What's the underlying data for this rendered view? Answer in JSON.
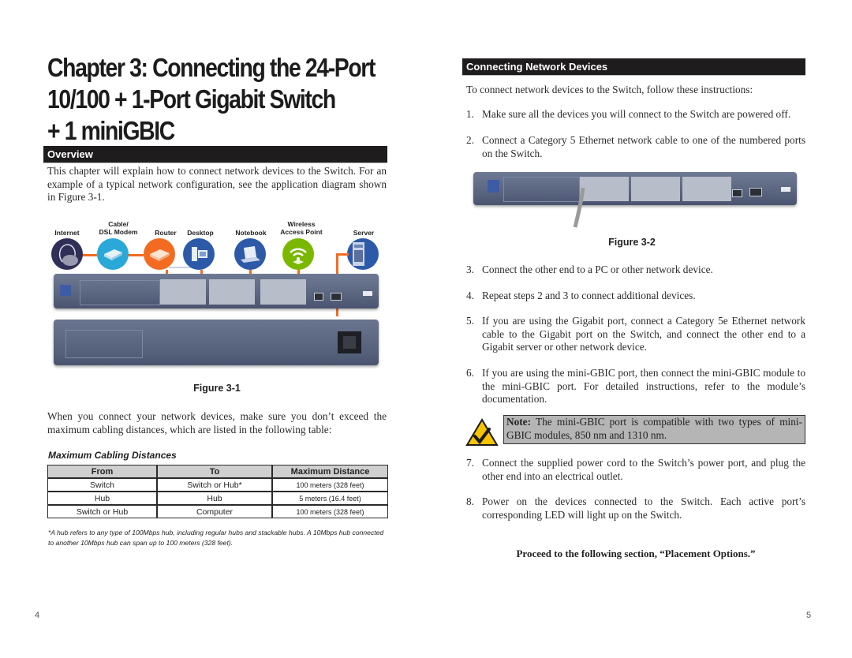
{
  "left_page": {
    "chapter_title_lines": [
      "Chapter 3: Connecting the 24-Port",
      "10/100 + 1-Port Gigabit Switch",
      "+ 1 miniGBIC"
    ],
    "overview": {
      "heading": "Overview",
      "paragraph": "This chapter will explain how to connect network devices to the Switch. For an example of a typical network configuration, see the application diagram shown in Figure 3-1."
    },
    "figure1": {
      "devices": [
        {
          "label": "Internet",
          "icon": "globe-icon",
          "color": "#2f2f57"
        },
        {
          "label": "Cable/\nDSL Modem",
          "icon": "modem-icon",
          "color": "#2aa8d8"
        },
        {
          "label": "Router",
          "icon": "router-icon",
          "color": "#f26b21"
        },
        {
          "label": "Desktop",
          "icon": "desktop-icon",
          "color": "#2d5aa8"
        },
        {
          "label": "Notebook",
          "icon": "notebook-icon",
          "color": "#2d5aa8"
        },
        {
          "label": "Wireless\nAccess Point",
          "icon": "wifi-icon",
          "color": "#7ab800"
        },
        {
          "label": "Server",
          "icon": "server-icon",
          "color": "#2d5aa8"
        }
      ],
      "caption": "Figure 3-1"
    },
    "cabling_paragraph": "When you connect your network devices, make sure you don’t exceed the maximum cabling distances, which are listed in the following table:",
    "table": {
      "title": "Maximum Cabling Distances",
      "headers": [
        "From",
        "To",
        "Maximum Distance"
      ],
      "rows": [
        [
          "Switch",
          "Switch or Hub*",
          "100 meters (328 feet)"
        ],
        [
          "Hub",
          "Hub",
          "5 meters (16.4 feet)"
        ],
        [
          "Switch or Hub",
          "Computer",
          "100 meters (328 feet)"
        ]
      ],
      "footnote": "*A hub refers to any type of 100Mbps hub, including regular hubs and stackable hubs. A 10Mbps hub connected to another 10Mbps hub can span up to 100 meters (328 feet)."
    },
    "page_number": "4"
  },
  "right_page": {
    "section_heading": "Connecting Network Devices",
    "intro": "To connect network devices to the Switch, follow these instructions:",
    "steps": [
      {
        "num": "1.",
        "text": "Make sure all the devices you will connect to the Switch are powered off."
      },
      {
        "num": "2.",
        "text": "Connect a Category 5 Ethernet network cable to one of the numbered ports on the Switch."
      },
      {
        "num": "3.",
        "text": "Connect the other end to a PC or other network device."
      },
      {
        "num": "4.",
        "text": "Repeat steps 2 and 3 to connect additional devices."
      },
      {
        "num": "5.",
        "text": "If you are using the Gigabit port, connect a Category 5e Ethernet network cable to the Gigabit port on the Switch, and connect the other end to a Gigabit server or other network device."
      },
      {
        "num": "6.",
        "text": "If you are using the mini-GBIC port, then connect the mini-GBIC module to the mini-GBIC port. For detailed instructions, refer to the module’s documentation."
      },
      {
        "num": "7.",
        "text": "Connect the supplied power cord to the Switch’s power port, and plug the other end into an electrical outlet."
      },
      {
        "num": "8.",
        "text": "Power on the devices connected to the Switch. Each active port’s corresponding LED will light up on the Switch."
      }
    ],
    "figure2_caption": "Figure 3-2",
    "note": {
      "label": "Note:",
      "text": " The mini-GBIC port is compatible with two types of mini-GBIC modules, 850 nm and 1310 nm.",
      "icon": "checkmark-warning-icon"
    },
    "proceed": "Proceed to the following section, “Placement Options.”",
    "page_number": "5"
  },
  "colors": {
    "section_bar": "#1f1c1d",
    "accent_orange": "#f26b21",
    "note_bg": "#b5b5b5",
    "switch_body": "#5a6580"
  }
}
